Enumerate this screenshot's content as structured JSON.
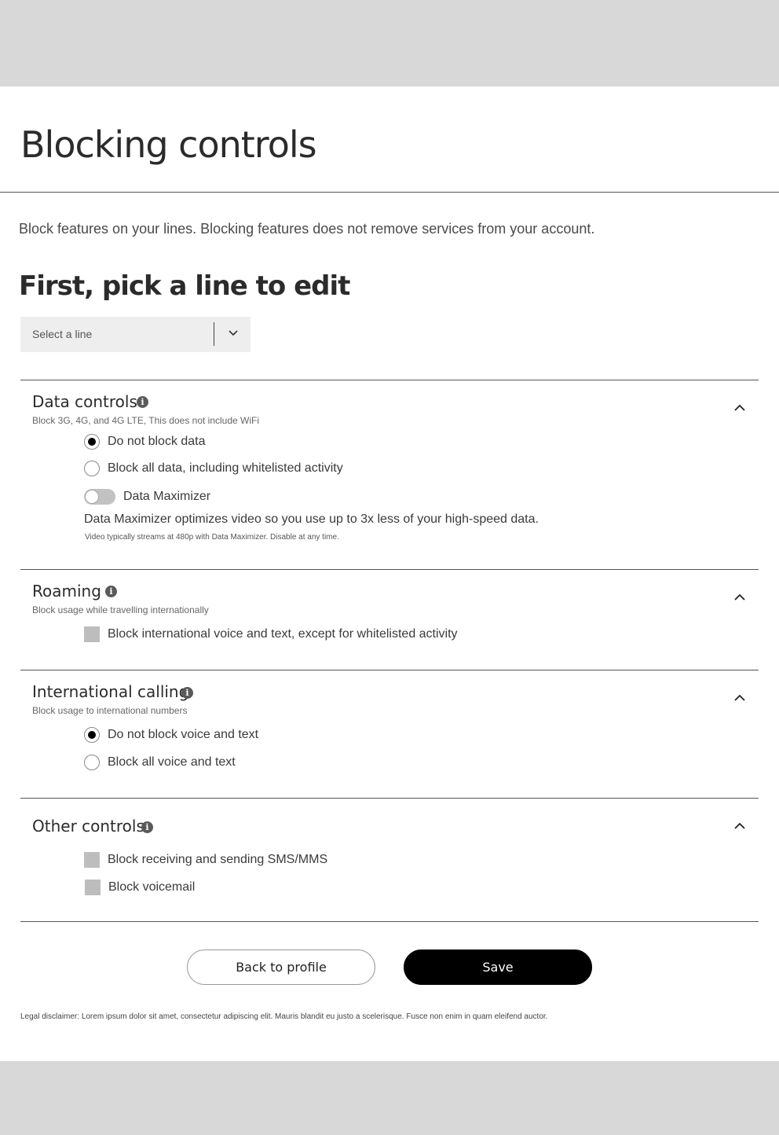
{
  "page": {
    "title": "Blocking controls",
    "intro": "Block features on your lines. Blocking features does not remove services from your account."
  },
  "line_picker": {
    "heading": "First, pick a line to edit",
    "select_label": "Select a line"
  },
  "sections": {
    "data_controls": {
      "title": "Data controls",
      "subtitle": "Block 3G, 4G, and 4G LTE, This does not include WiFi",
      "options": [
        {
          "label": "Do not block data",
          "selected": true
        },
        {
          "label": "Block all data, including whitelisted activity",
          "selected": false
        }
      ],
      "toggle": {
        "label": "Data Maximizer",
        "on": false,
        "description": "Data Maximizer optimizes video so you use up to 3x less of your high-speed data.",
        "note": "Video typically streams at 480p with Data Maximizer. Disable at any time."
      }
    },
    "roaming": {
      "title": "Roaming",
      "subtitle": "Block usage while travelling internationally",
      "checkboxes": [
        {
          "label": "Block international voice and text, except for whitelisted activity",
          "checked": false
        }
      ]
    },
    "international_calling": {
      "title": "International calling",
      "subtitle": "Block usage to international numbers",
      "options": [
        {
          "label": "Do not block voice and text",
          "selected": true
        },
        {
          "label": "Block all voice and text",
          "selected": false
        }
      ]
    },
    "other_controls": {
      "title": "Other controls",
      "checkboxes": [
        {
          "label": "Block receiving and sending SMS/MMS",
          "checked": false
        },
        {
          "label": "Block voicemail",
          "checked": false
        }
      ]
    }
  },
  "buttons": {
    "back_label": "Back to profile",
    "save_label": "Save"
  },
  "legal": "Legal disclaimer: Lorem ipsum dolor sit amet, consectetur adipiscing elit. Mauris blandit eu justo a scelerisque. Fusce non enim in quam eleifend auctor.",
  "icons": {
    "info": "info-icon",
    "collapse": "chevron-up-icon",
    "dropdown": "chevron-down-icon"
  },
  "colors": {
    "band": "#d8d8d8",
    "primary_button": "#000000",
    "text": "#333333"
  }
}
